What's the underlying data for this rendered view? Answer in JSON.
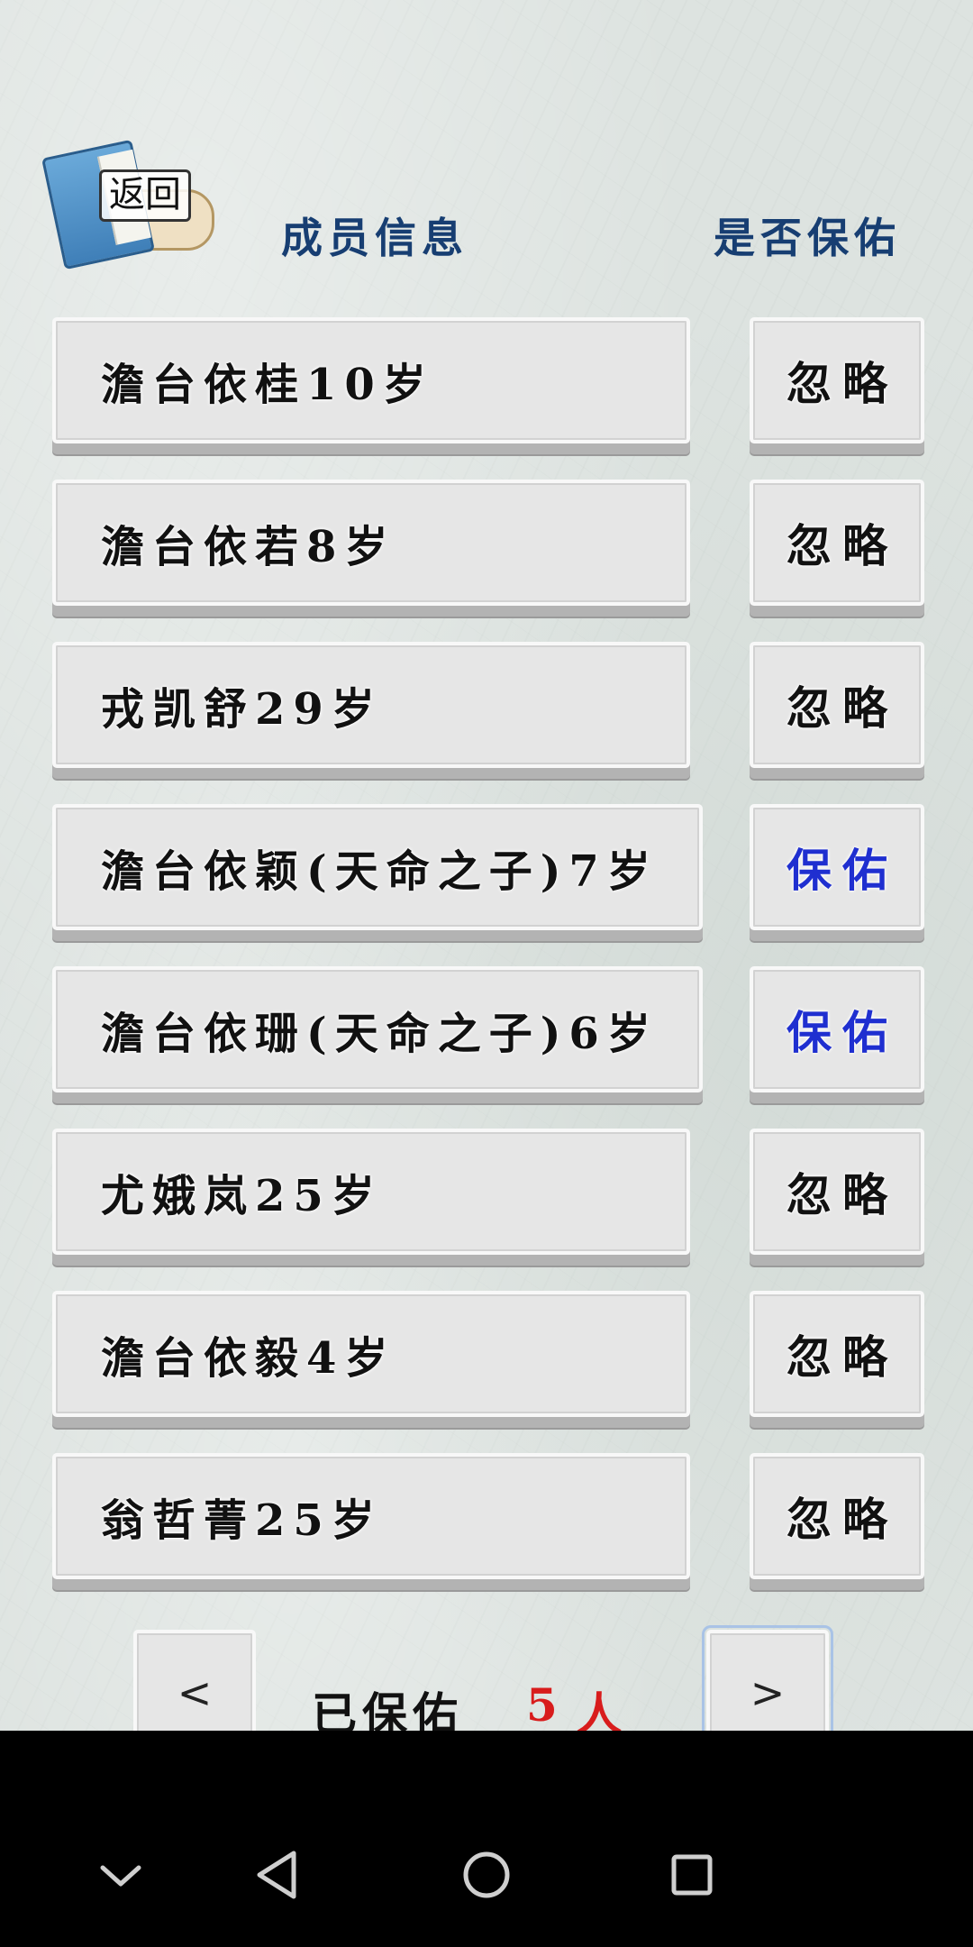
{
  "header": {
    "back_label": "返回",
    "member_info": "成员信息",
    "bless_question": "是否保佑"
  },
  "members": [
    {
      "name": "澹台依桂10岁",
      "action": "忽略",
      "state": "ignore"
    },
    {
      "name": "澹台依若8岁",
      "action": "忽略",
      "state": "ignore"
    },
    {
      "name": "戎凯舒29岁",
      "action": "忽略",
      "state": "ignore"
    },
    {
      "name": "澹台依颖(天命之子)7岁",
      "action": "保佑",
      "state": "bless"
    },
    {
      "name": "澹台依珊(天命之子)6岁",
      "action": "保佑",
      "state": "bless"
    },
    {
      "name": "尤娥岚25岁",
      "action": "忽略",
      "state": "ignore"
    },
    {
      "name": "澹台依毅4岁",
      "action": "忽略",
      "state": "ignore"
    },
    {
      "name": "翁哲菁25岁",
      "action": "忽略",
      "state": "ignore"
    }
  ],
  "footer": {
    "prev_label": "<",
    "next_label": ">",
    "blessed_label": "已保佑",
    "blessed_count": "5",
    "blessed_unit": "人"
  },
  "colors": {
    "header_text": "#173e72",
    "bless_text": "#1f2fd0",
    "count_text": "#d81c1c"
  },
  "system_nav": {
    "icons": [
      "chevron-down-icon",
      "back-triangle-icon",
      "home-circle-icon",
      "recents-square-icon"
    ]
  }
}
